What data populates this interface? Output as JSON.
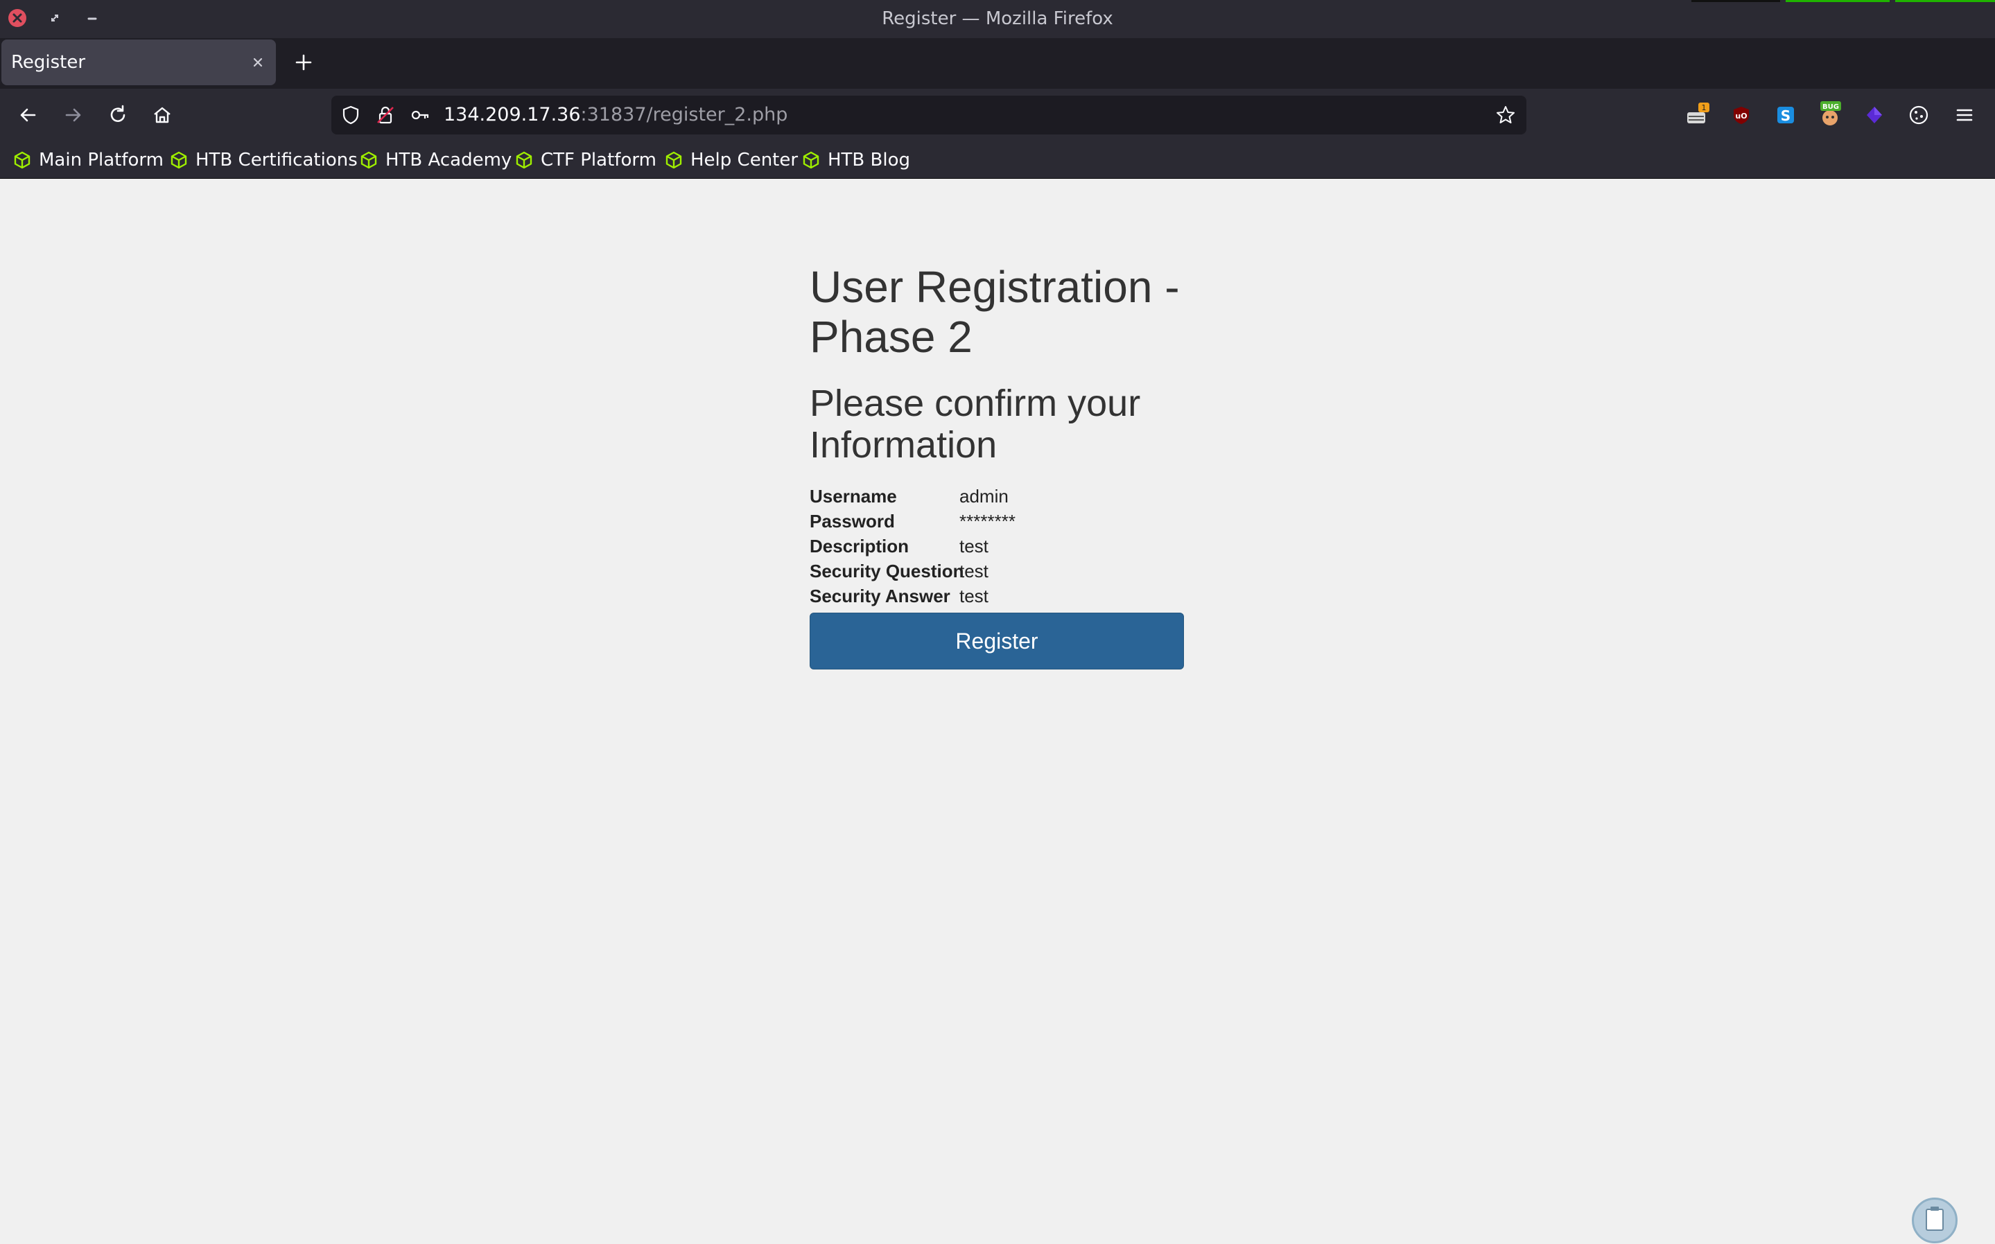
{
  "window": {
    "title": "Register — Mozilla Firefox"
  },
  "tabs": [
    {
      "label": "Register",
      "active": true
    }
  ],
  "urlbar": {
    "host": "134.209.17.36",
    "rest": ":31837/register_2.php"
  },
  "bookmarks": [
    {
      "label": "Main Platform"
    },
    {
      "label": "HTB Certifications"
    },
    {
      "label": "HTB Academy"
    },
    {
      "label": "CTF Platform"
    },
    {
      "label": "Help Center"
    },
    {
      "label": "HTB Blog"
    }
  ],
  "extensions": {
    "badge_count": "1",
    "bug_label": "BUG"
  },
  "page": {
    "heading": "User Registration - Phase 2",
    "subheading": "Please confirm your Information",
    "fields": [
      {
        "label": "Username",
        "value": "admin"
      },
      {
        "label": "Password",
        "value": "********"
      },
      {
        "label": "Description",
        "value": "test"
      },
      {
        "label": "Security Question",
        "value": "test"
      },
      {
        "label": "Security Answer",
        "value": "test"
      }
    ],
    "register_label": "Register"
  },
  "colors": {
    "accent": "#2a6496",
    "bookmark_icon": "#9fef00",
    "chrome_bg": "#2b2a33"
  }
}
